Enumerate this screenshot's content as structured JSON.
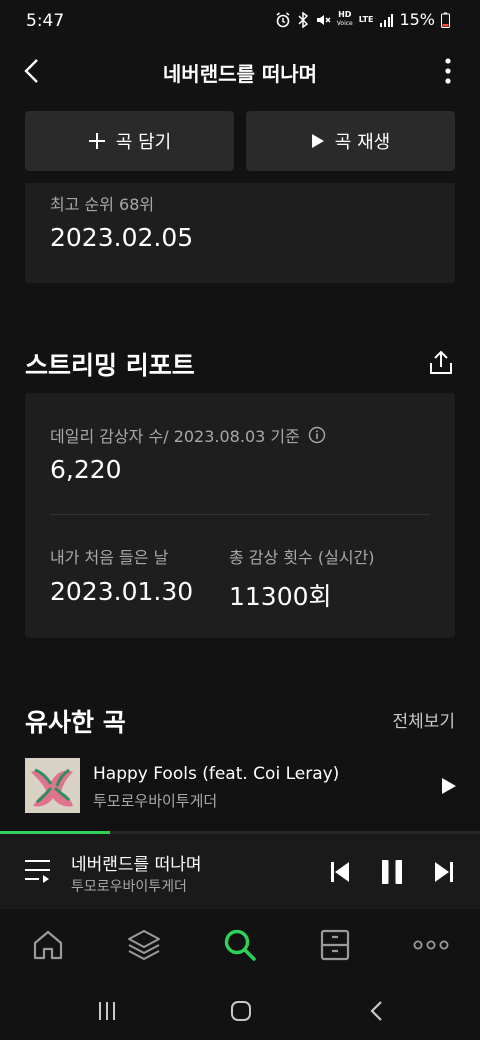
{
  "status_bar": {
    "time": "5:47",
    "hd": "HD",
    "voice": "Voice",
    "lte": "LTE",
    "battery": "15%"
  },
  "header": {
    "title": "네버랜드를 떠나며",
    "back_icon": "chevron-left-icon",
    "more_icon": "vertical-dots-icon"
  },
  "actions": {
    "add_label": "곡 담기",
    "play_label": "곡 재생"
  },
  "chart_card": {
    "peak_rank": "최고 순위 68위",
    "date": "2023.02.05"
  },
  "streaming_report": {
    "title": "스트리밍 리포트",
    "daily_label": "데일리 감상자 수/ 2023.08.03 기준",
    "daily_value": "6,220",
    "first_listen_label": "내가 처음 들은 날",
    "first_listen_value": "2023.01.30",
    "total_plays_label": "총 감상 횟수 (실시간)",
    "total_plays_value": "11300회"
  },
  "similar": {
    "title": "유사한 곡",
    "view_all": "전체보기",
    "songs": [
      {
        "title": "Happy Fools (feat. Coi Leray)",
        "artist": "투모로우바이투게더"
      }
    ]
  },
  "mini_player": {
    "title": "네버랜드를 떠나며",
    "artist": "투모로우바이투게더",
    "progress": 0.23
  },
  "colors": {
    "accent": "#2fd158",
    "background": "#121212",
    "card": "#1e1e1e",
    "button": "#2a2a2a"
  }
}
